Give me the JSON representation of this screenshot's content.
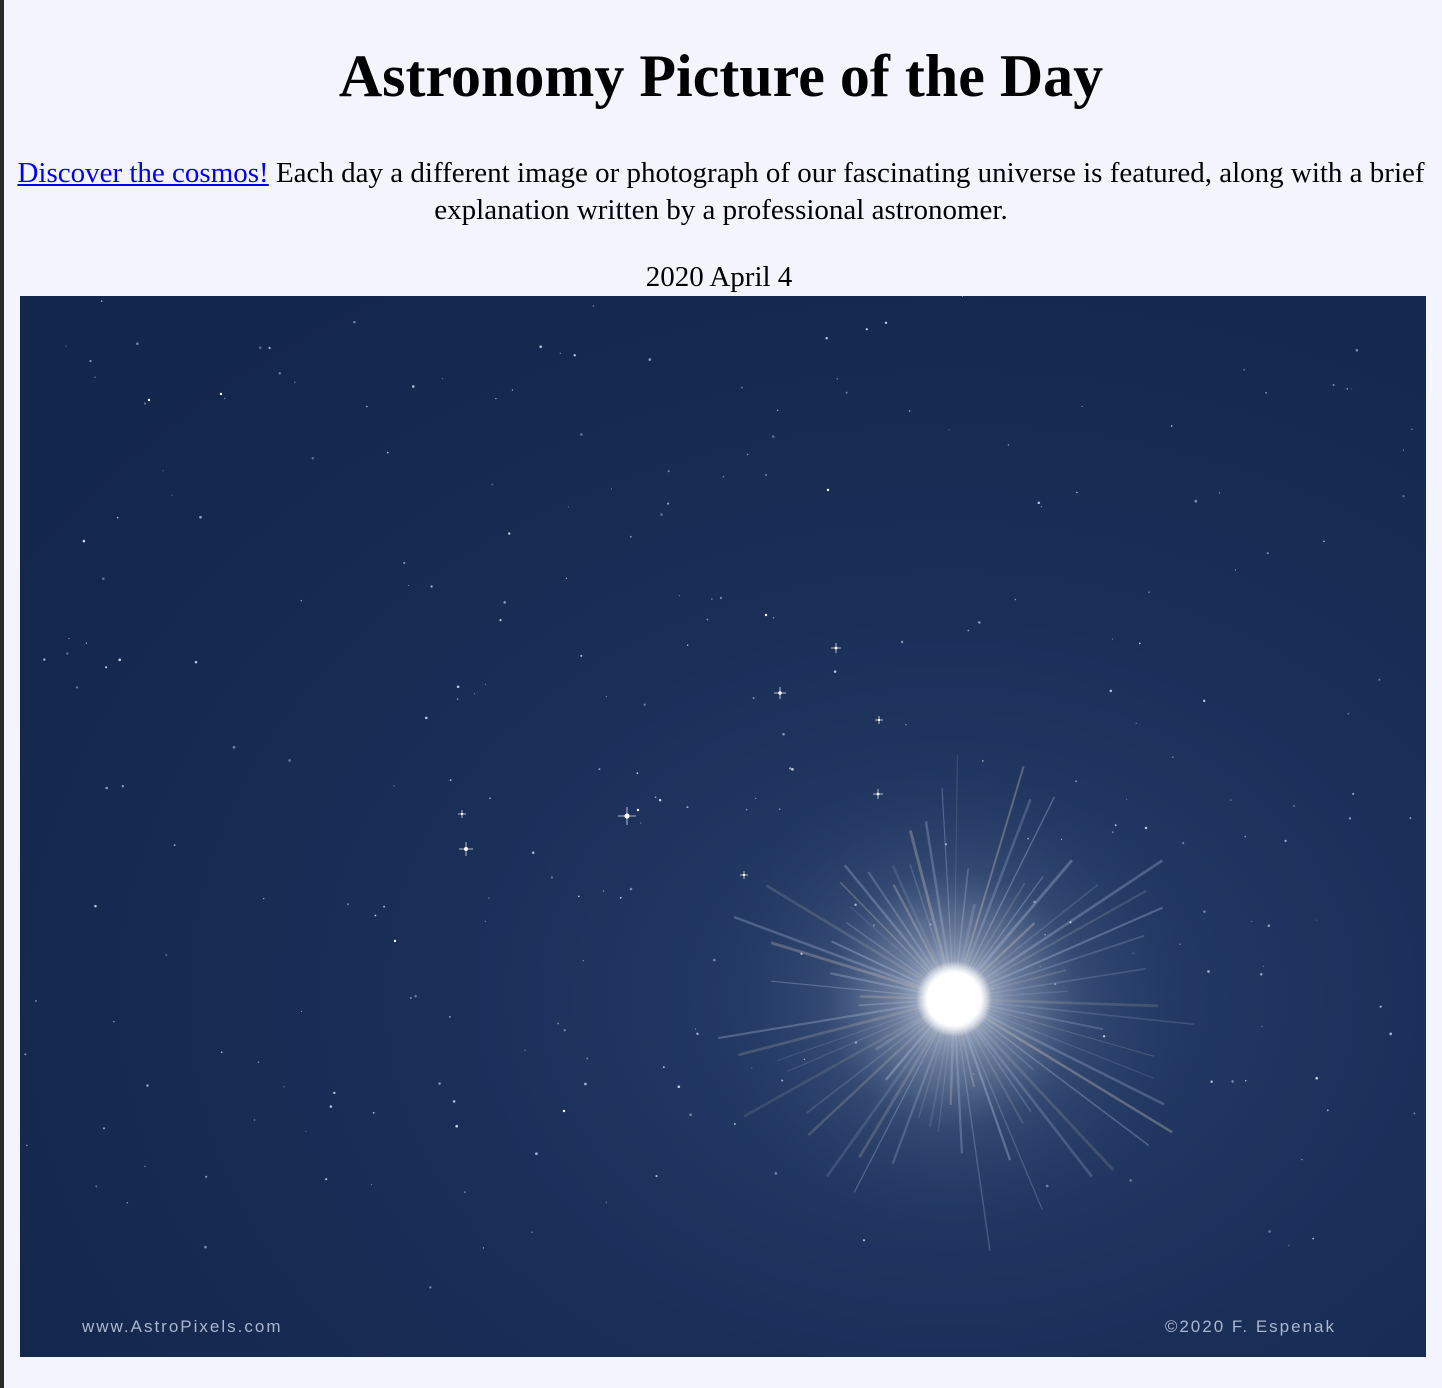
{
  "header": {
    "title": "Astronomy Picture of the Day"
  },
  "intro": {
    "link_text": "Discover the cosmos!",
    "text": " Each day a different image or photograph of our fascinating universe is featured, along with a brief explanation written by a professional astronomer."
  },
  "apod": {
    "date": "2020 April 4",
    "image": {
      "watermark_left": "www.AstroPixels.com",
      "watermark_right": "©2020 F. Espenak"
    }
  },
  "colors": {
    "page_background": "#f3f4fd",
    "link": "#0000ee",
    "sky": "#14284d"
  }
}
